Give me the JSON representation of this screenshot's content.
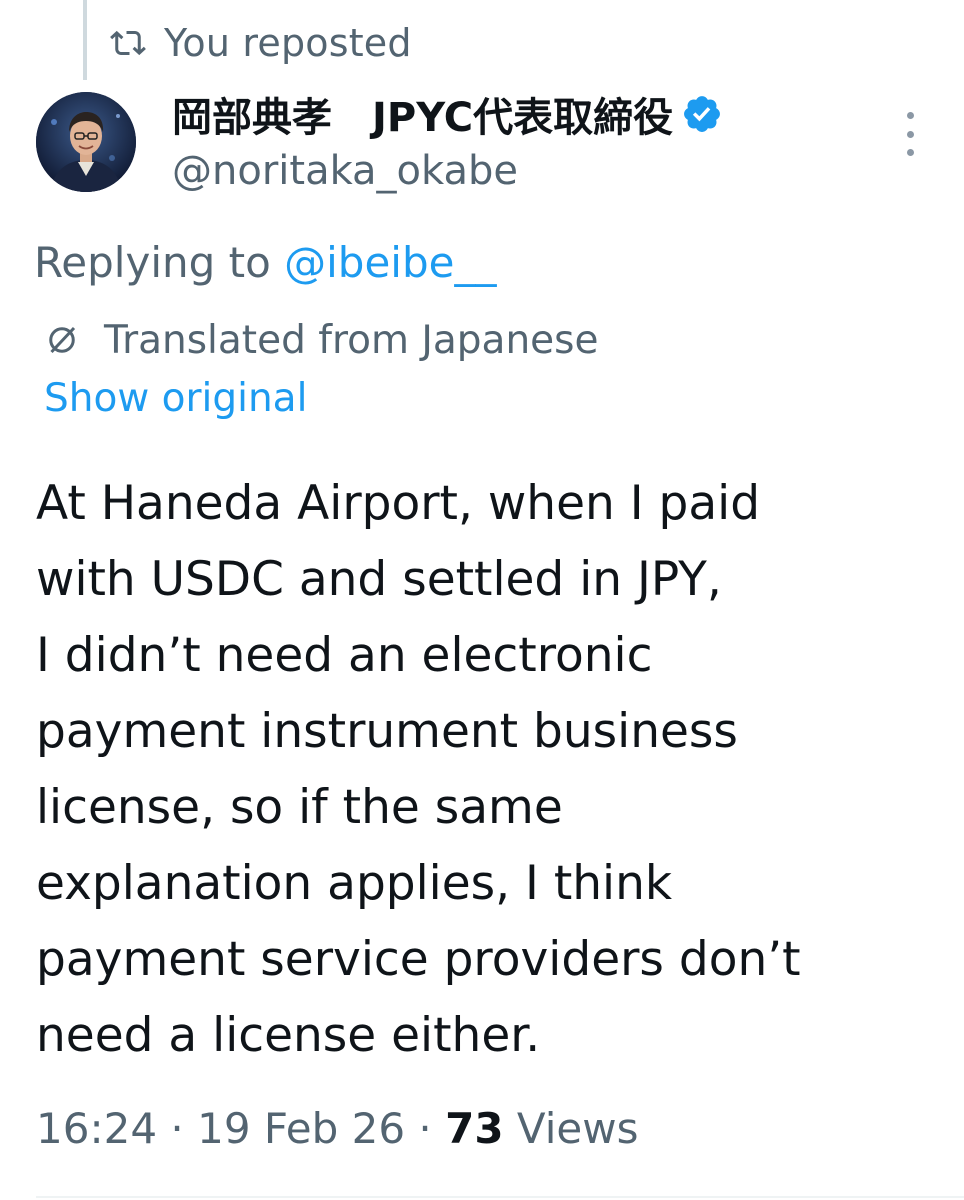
{
  "repost": {
    "label": "You reposted",
    "icon": "repost-icon"
  },
  "author": {
    "display_name": "岡部典孝　JPYC代表取締役",
    "handle": "@noritaka_okabe",
    "verified": true,
    "verified_color": "#1d9bf0",
    "avatar_icon": "avatar-photo"
  },
  "reply": {
    "prefix": "Replying to ",
    "mention": "@ibeibe__"
  },
  "translation": {
    "label": "Translated from Japanese",
    "icon": "translate-icon",
    "show_original": "Show original"
  },
  "tweet": {
    "lines": [
      "At Haneda Airport, when I paid",
      "with USDC and settled in JPY,",
      "I didn’t need an electronic",
      "payment instrument business",
      "license, so if the same",
      "explanation applies, I think",
      "payment service providers don’t",
      "need a license either."
    ]
  },
  "meta": {
    "time": "16:24",
    "separator": " · ",
    "date": "19 Feb 26",
    "views_count": "73",
    "views_label": " Views"
  },
  "colors": {
    "link": "#1d9bf0",
    "secondary_text": "#536471",
    "primary_text": "#0f1419"
  }
}
